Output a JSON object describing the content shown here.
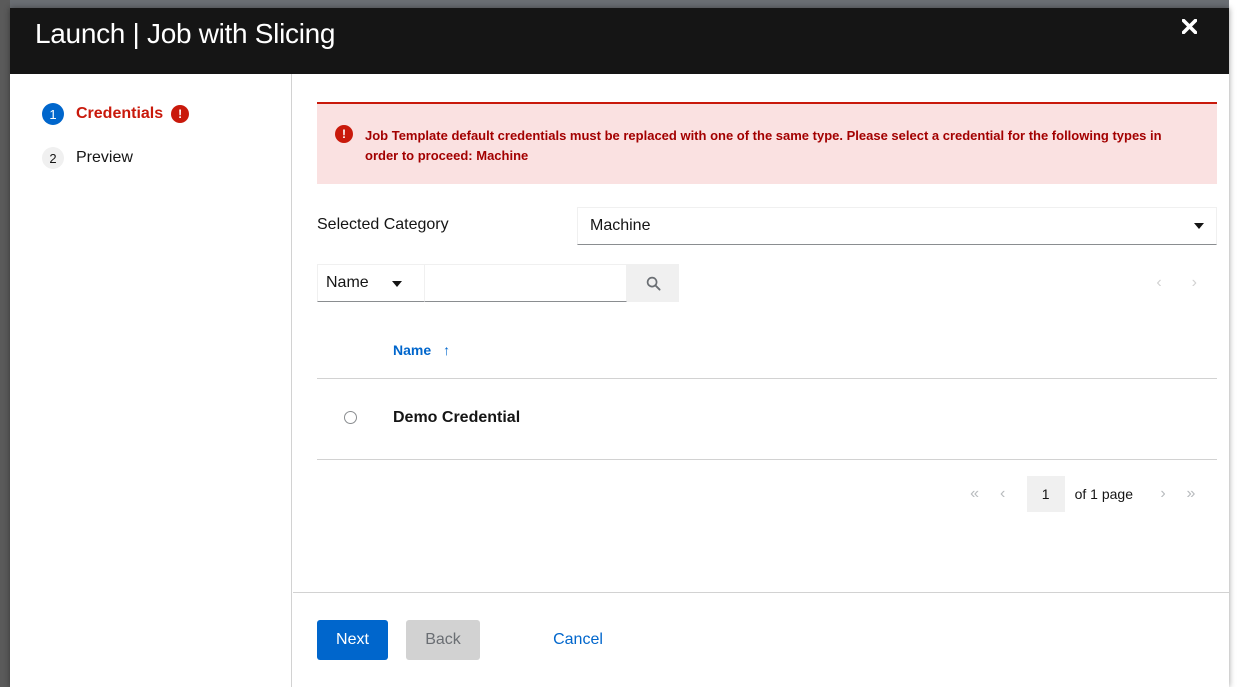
{
  "modal": {
    "title": "Launch | Job with Slicing"
  },
  "wizard_nav": {
    "steps": [
      {
        "number": "1",
        "label": "Credentials",
        "state": "active-error",
        "error_glyph": "!"
      },
      {
        "number": "2",
        "label": "Preview",
        "state": "inactive"
      }
    ]
  },
  "alert": {
    "icon": "exclamation-circle-icon",
    "text": "Job Template default credentials must be replaced with one of the same type. Please select a credential for the following types in order to proceed: Machine",
    "glyph": "!"
  },
  "category": {
    "label": "Selected Category",
    "value": "Machine"
  },
  "filter": {
    "field": "Name",
    "search_value": ""
  },
  "table": {
    "columns": [
      {
        "label": "Name",
        "sort": "ascending",
        "sort_glyph": "↑"
      }
    ],
    "rows": [
      {
        "name": "Demo Credential",
        "selected": false
      }
    ]
  },
  "pagination": {
    "first_glyph": "«",
    "prev_glyph": "‹",
    "next_glyph": "›",
    "last_glyph": "»",
    "current_page": "1",
    "of_text": "of 1 page"
  },
  "footer": {
    "next_label": "Next",
    "back_label": "Back",
    "cancel_label": "Cancel"
  },
  "colors": {
    "primary": "#0066cc",
    "danger": "#c9190b",
    "alert_bg": "#fae1e1",
    "header_bg": "#151515"
  }
}
